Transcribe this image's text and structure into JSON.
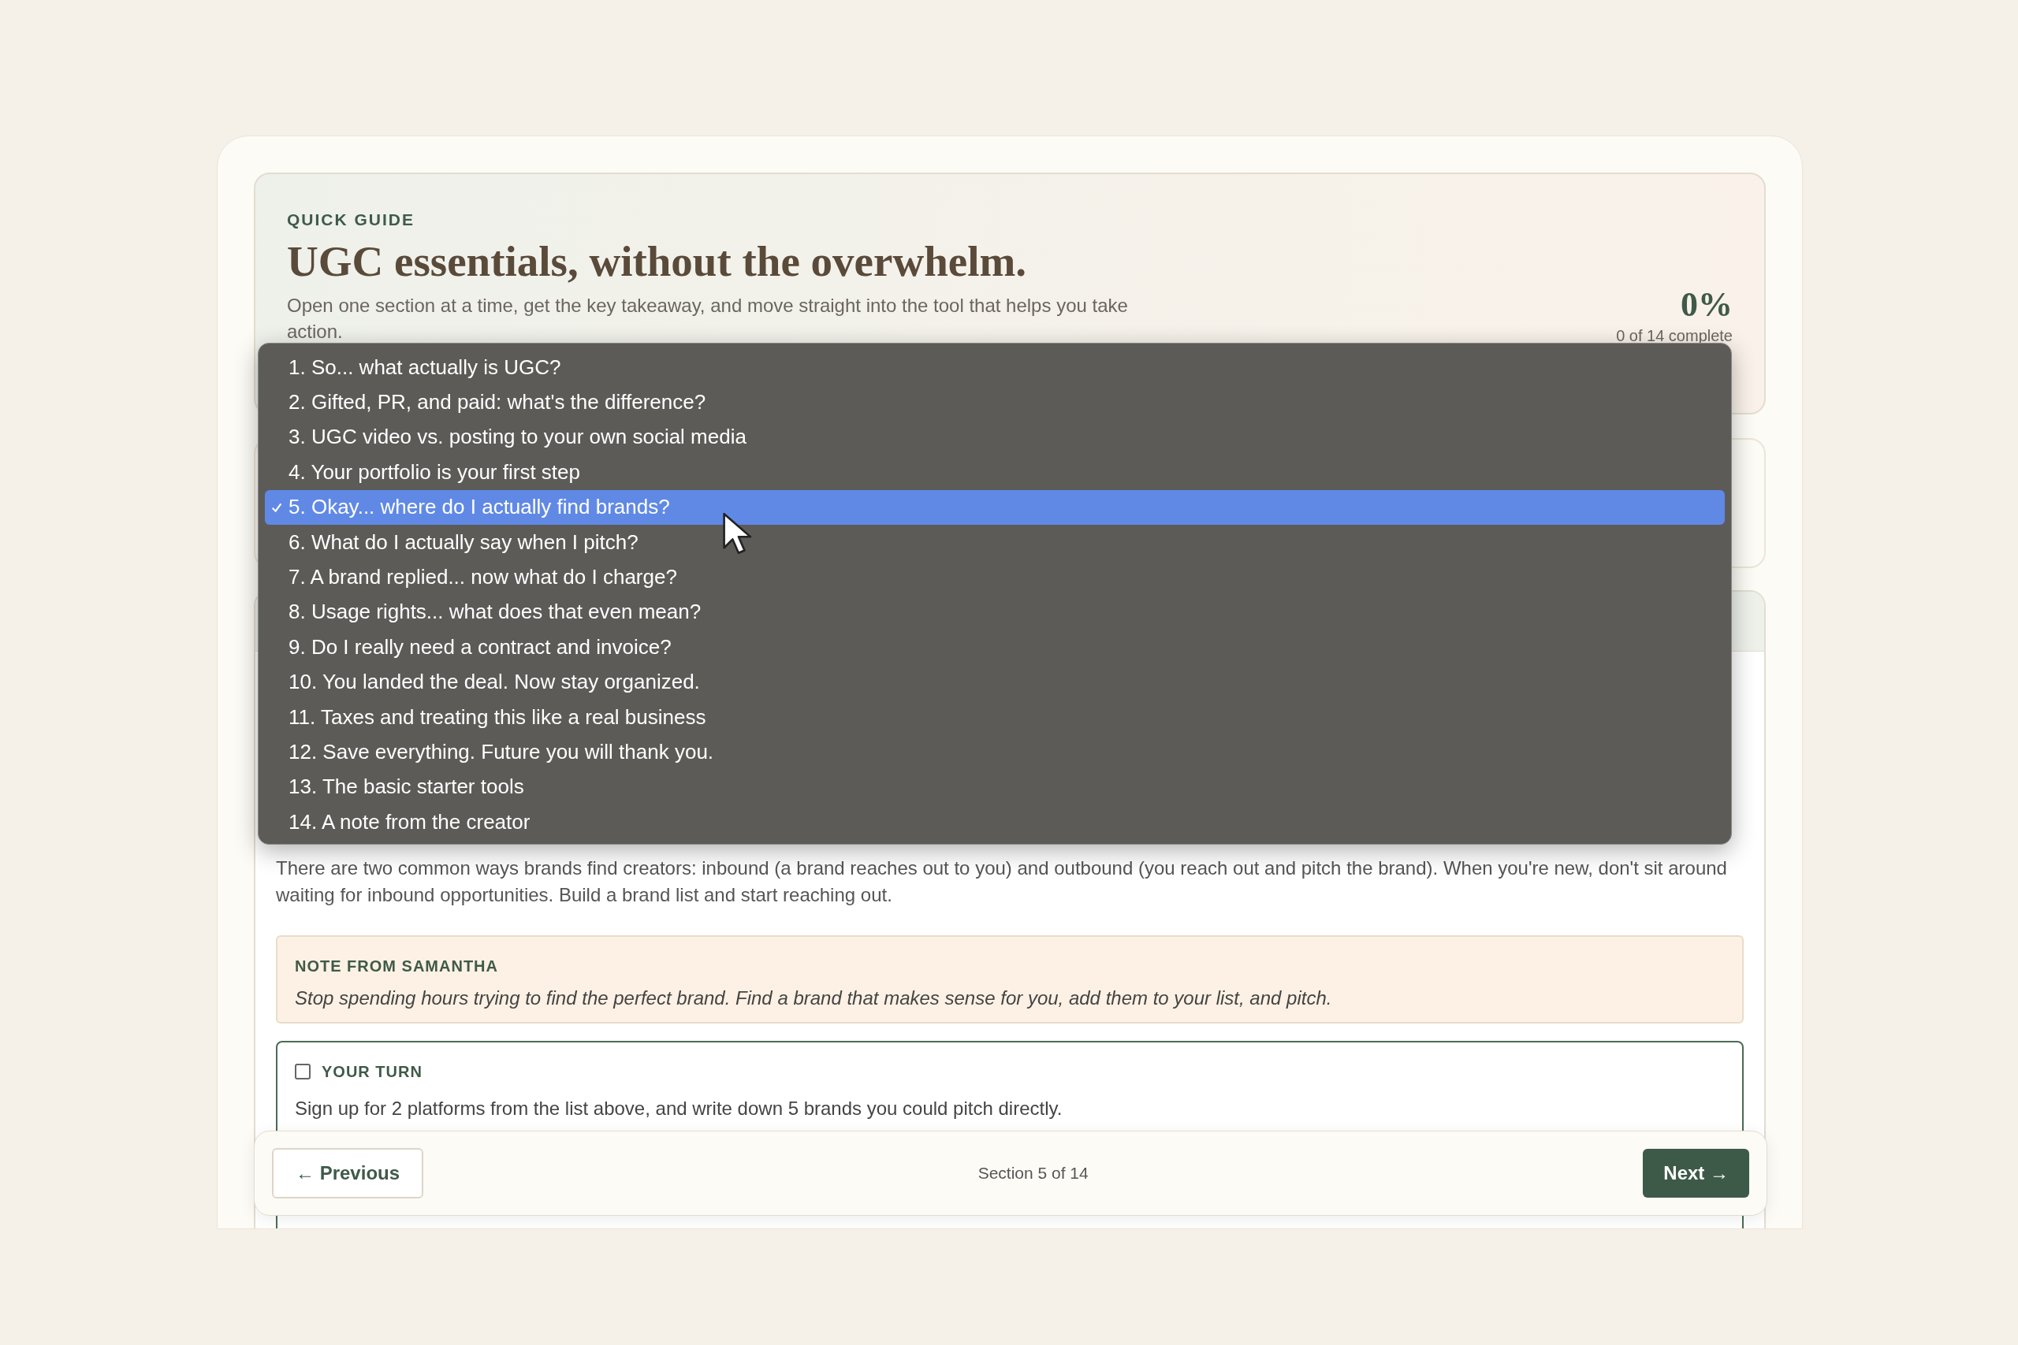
{
  "header": {
    "eyebrow": "QUICK GUIDE",
    "title": "UGC essentials, without the overwhelm.",
    "description": "Open one section at a time, get the key takeaway, and move straight into the tool that helps you take action.",
    "percent": "0%",
    "progress_text": "0 of 14 complete"
  },
  "section_menu": {
    "items": [
      {
        "label": "1. So... what actually is UGC?",
        "selected": false
      },
      {
        "label": "2. Gifted, PR, and paid: what's the difference?",
        "selected": false
      },
      {
        "label": "3. UGC video vs. posting to your own social media",
        "selected": false
      },
      {
        "label": "4. Your portfolio is your first step",
        "selected": false
      },
      {
        "label": "5. Okay... where do I actually find brands?",
        "selected": true
      },
      {
        "label": "6. What do I actually say when I pitch?",
        "selected": false
      },
      {
        "label": "7. A brand replied... now what do I charge?",
        "selected": false
      },
      {
        "label": "8. Usage rights... what does that even mean?",
        "selected": false
      },
      {
        "label": "9. Do I really need a contract and invoice?",
        "selected": false
      },
      {
        "label": "10. You landed the deal. Now stay organized.",
        "selected": false
      },
      {
        "label": "11. Taxes and treating this like a real business",
        "selected": false
      },
      {
        "label": "12. Save everything. Future you will thank you.",
        "selected": false
      },
      {
        "label": "13. The basic starter tools",
        "selected": false
      },
      {
        "label": "14. A note from the creator",
        "selected": false
      }
    ]
  },
  "section": {
    "body": "There are two common ways brands find creators: inbound (a brand reaches out to you) and outbound (you reach out and pitch the brand). When you're new, don't sit around waiting for inbound opportunities. Build a brand list and start reaching out.",
    "note": {
      "title": "NOTE FROM SAMANTHA",
      "text": "Stop spending hours trying to find the perfect brand. Find a brand that makes sense for you, add them to your list, and pitch."
    },
    "your_turn": {
      "title": "YOUR TURN",
      "checked": false,
      "text": "Sign up for 2 platforms from the list above, and write down 5 brands you could pitch directly."
    }
  },
  "nav": {
    "previous": "← Previous",
    "position": "Section 5 of 14",
    "next": "Next →"
  }
}
